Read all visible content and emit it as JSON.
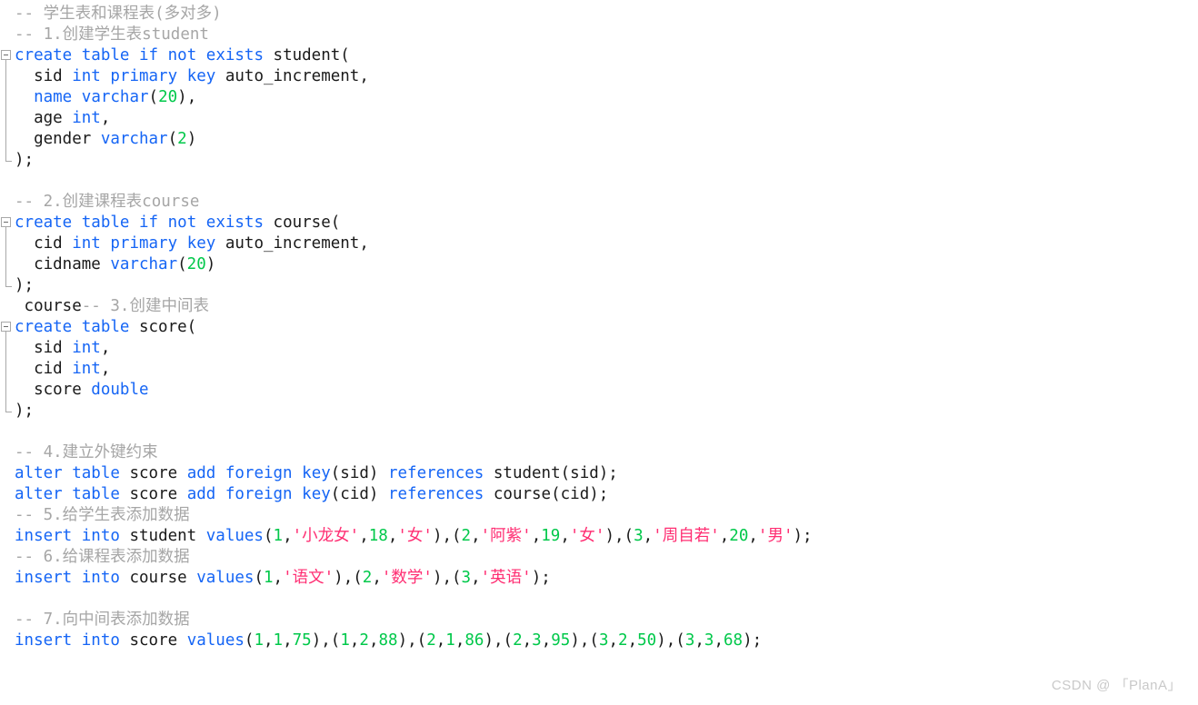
{
  "editor": {
    "language": "sql",
    "background_color": "#ffffff",
    "colors": {
      "keyword": "#1565f5",
      "string": "#ff2d72",
      "number": "#00c84a",
      "comment": "#a6a6a6",
      "text": "#1a1a1a",
      "fold_marker": "#a8a8a8"
    }
  },
  "watermark": {
    "text": "CSDN @ 「PlanA」"
  },
  "code_lines": [
    {
      "n": 1,
      "tokens": [
        {
          "t": "-- 学生表和课程表(多对多)",
          "c": "cmt"
        }
      ]
    },
    {
      "n": 2,
      "tokens": [
        {
          "t": "-- 1.创建学生表student",
          "c": "cmt"
        }
      ]
    },
    {
      "n": 3,
      "fold": "start",
      "tokens": [
        {
          "t": "create",
          "c": "kw"
        },
        {
          "t": " ",
          "c": "plain"
        },
        {
          "t": "table",
          "c": "kw"
        },
        {
          "t": " ",
          "c": "plain"
        },
        {
          "t": "if",
          "c": "kw"
        },
        {
          "t": " ",
          "c": "plain"
        },
        {
          "t": "not",
          "c": "kw"
        },
        {
          "t": " ",
          "c": "plain"
        },
        {
          "t": "exists",
          "c": "kw"
        },
        {
          "t": " student(",
          "c": "plain"
        }
      ]
    },
    {
      "n": 4,
      "tokens": [
        {
          "t": "  sid ",
          "c": "plain"
        },
        {
          "t": "int",
          "c": "kw"
        },
        {
          "t": " ",
          "c": "plain"
        },
        {
          "t": "primary",
          "c": "kw"
        },
        {
          "t": " ",
          "c": "plain"
        },
        {
          "t": "key",
          "c": "kw"
        },
        {
          "t": " auto_increment,",
          "c": "plain"
        }
      ]
    },
    {
      "n": 5,
      "tokens": [
        {
          "t": "  ",
          "c": "plain"
        },
        {
          "t": "name",
          "c": "kw"
        },
        {
          "t": " ",
          "c": "plain"
        },
        {
          "t": "varchar",
          "c": "kw"
        },
        {
          "t": "(",
          "c": "punct"
        },
        {
          "t": "20",
          "c": "num"
        },
        {
          "t": "),",
          "c": "punct"
        }
      ]
    },
    {
      "n": 6,
      "tokens": [
        {
          "t": "  age ",
          "c": "plain"
        },
        {
          "t": "int",
          "c": "kw"
        },
        {
          "t": ",",
          "c": "punct"
        }
      ]
    },
    {
      "n": 7,
      "tokens": [
        {
          "t": "  gender ",
          "c": "plain"
        },
        {
          "t": "varchar",
          "c": "kw"
        },
        {
          "t": "(",
          "c": "punct"
        },
        {
          "t": "2",
          "c": "num"
        },
        {
          "t": ")",
          "c": "punct"
        }
      ]
    },
    {
      "n": 8,
      "fold": "end",
      "tokens": [
        {
          "t": ");",
          "c": "plain"
        }
      ]
    },
    {
      "n": 9,
      "tokens": [
        {
          "t": "",
          "c": "plain"
        }
      ]
    },
    {
      "n": 10,
      "tokens": [
        {
          "t": "-- 2.创建课程表course",
          "c": "cmt"
        }
      ]
    },
    {
      "n": 11,
      "fold": "start",
      "tokens": [
        {
          "t": "create",
          "c": "kw"
        },
        {
          "t": " ",
          "c": "plain"
        },
        {
          "t": "table",
          "c": "kw"
        },
        {
          "t": " ",
          "c": "plain"
        },
        {
          "t": "if",
          "c": "kw"
        },
        {
          "t": " ",
          "c": "plain"
        },
        {
          "t": "not",
          "c": "kw"
        },
        {
          "t": " ",
          "c": "plain"
        },
        {
          "t": "exists",
          "c": "kw"
        },
        {
          "t": " course(",
          "c": "plain"
        }
      ]
    },
    {
      "n": 12,
      "tokens": [
        {
          "t": "  cid ",
          "c": "plain"
        },
        {
          "t": "int",
          "c": "kw"
        },
        {
          "t": " ",
          "c": "plain"
        },
        {
          "t": "primary",
          "c": "kw"
        },
        {
          "t": " ",
          "c": "plain"
        },
        {
          "t": "key",
          "c": "kw"
        },
        {
          "t": " auto_increment,",
          "c": "plain"
        }
      ]
    },
    {
      "n": 13,
      "tokens": [
        {
          "t": "  cidname ",
          "c": "plain"
        },
        {
          "t": "varchar",
          "c": "kw"
        },
        {
          "t": "(",
          "c": "punct"
        },
        {
          "t": "20",
          "c": "num"
        },
        {
          "t": ")",
          "c": "punct"
        }
      ]
    },
    {
      "n": 14,
      "fold": "end",
      "tokens": [
        {
          "t": ");",
          "c": "plain"
        }
      ]
    },
    {
      "n": 15,
      "tokens": [
        {
          "t": " course",
          "c": "plain"
        },
        {
          "t": "-- 3.创建中间表",
          "c": "cmt"
        }
      ]
    },
    {
      "n": 16,
      "fold": "start",
      "tokens": [
        {
          "t": "create",
          "c": "kw"
        },
        {
          "t": " ",
          "c": "plain"
        },
        {
          "t": "table",
          "c": "kw"
        },
        {
          "t": " score(",
          "c": "plain"
        }
      ]
    },
    {
      "n": 17,
      "tokens": [
        {
          "t": "  sid ",
          "c": "plain"
        },
        {
          "t": "int",
          "c": "kw"
        },
        {
          "t": ",",
          "c": "punct"
        }
      ]
    },
    {
      "n": 18,
      "tokens": [
        {
          "t": "  cid ",
          "c": "plain"
        },
        {
          "t": "int",
          "c": "kw"
        },
        {
          "t": ",",
          "c": "punct"
        }
      ]
    },
    {
      "n": 19,
      "tokens": [
        {
          "t": "  score ",
          "c": "plain"
        },
        {
          "t": "double",
          "c": "kw"
        }
      ]
    },
    {
      "n": 20,
      "fold": "end",
      "tokens": [
        {
          "t": ");",
          "c": "plain"
        }
      ]
    },
    {
      "n": 21,
      "tokens": [
        {
          "t": "",
          "c": "plain"
        }
      ]
    },
    {
      "n": 22,
      "tokens": [
        {
          "t": "-- 4.建立外键约束",
          "c": "cmt"
        }
      ]
    },
    {
      "n": 23,
      "tokens": [
        {
          "t": "alter",
          "c": "kw"
        },
        {
          "t": " ",
          "c": "plain"
        },
        {
          "t": "table",
          "c": "kw"
        },
        {
          "t": " score ",
          "c": "plain"
        },
        {
          "t": "add",
          "c": "kw"
        },
        {
          "t": " ",
          "c": "plain"
        },
        {
          "t": "foreign",
          "c": "kw"
        },
        {
          "t": " ",
          "c": "plain"
        },
        {
          "t": "key",
          "c": "kw"
        },
        {
          "t": "(sid) ",
          "c": "plain"
        },
        {
          "t": "references",
          "c": "kw"
        },
        {
          "t": " student(sid);",
          "c": "plain"
        }
      ]
    },
    {
      "n": 24,
      "tokens": [
        {
          "t": "alter",
          "c": "kw"
        },
        {
          "t": " ",
          "c": "plain"
        },
        {
          "t": "table",
          "c": "kw"
        },
        {
          "t": " score ",
          "c": "plain"
        },
        {
          "t": "add",
          "c": "kw"
        },
        {
          "t": " ",
          "c": "plain"
        },
        {
          "t": "foreign",
          "c": "kw"
        },
        {
          "t": " ",
          "c": "plain"
        },
        {
          "t": "key",
          "c": "kw"
        },
        {
          "t": "(cid) ",
          "c": "plain"
        },
        {
          "t": "references",
          "c": "kw"
        },
        {
          "t": " course(cid);",
          "c": "plain"
        }
      ]
    },
    {
      "n": 25,
      "tokens": [
        {
          "t": "-- 5.给学生表添加数据",
          "c": "cmt"
        }
      ]
    },
    {
      "n": 26,
      "tokens": [
        {
          "t": "insert",
          "c": "kw"
        },
        {
          "t": " ",
          "c": "plain"
        },
        {
          "t": "into",
          "c": "kw"
        },
        {
          "t": " student ",
          "c": "plain"
        },
        {
          "t": "values",
          "c": "kw"
        },
        {
          "t": "(",
          "c": "punct"
        },
        {
          "t": "1",
          "c": "num"
        },
        {
          "t": ",",
          "c": "punct"
        },
        {
          "t": "'小龙女'",
          "c": "str"
        },
        {
          "t": ",",
          "c": "punct"
        },
        {
          "t": "18",
          "c": "num"
        },
        {
          "t": ",",
          "c": "punct"
        },
        {
          "t": "'女'",
          "c": "str"
        },
        {
          "t": "),(",
          "c": "punct"
        },
        {
          "t": "2",
          "c": "num"
        },
        {
          "t": ",",
          "c": "punct"
        },
        {
          "t": "'阿紫'",
          "c": "str"
        },
        {
          "t": ",",
          "c": "punct"
        },
        {
          "t": "19",
          "c": "num"
        },
        {
          "t": ",",
          "c": "punct"
        },
        {
          "t": "'女'",
          "c": "str"
        },
        {
          "t": "),(",
          "c": "punct"
        },
        {
          "t": "3",
          "c": "num"
        },
        {
          "t": ",",
          "c": "punct"
        },
        {
          "t": "'周自若'",
          "c": "str"
        },
        {
          "t": ",",
          "c": "punct"
        },
        {
          "t": "20",
          "c": "num"
        },
        {
          "t": ",",
          "c": "punct"
        },
        {
          "t": "'男'",
          "c": "str"
        },
        {
          "t": ");",
          "c": "punct"
        }
      ]
    },
    {
      "n": 27,
      "tokens": [
        {
          "t": "-- 6.给课程表添加数据",
          "c": "cmt"
        }
      ]
    },
    {
      "n": 28,
      "tokens": [
        {
          "t": "insert",
          "c": "kw"
        },
        {
          "t": " ",
          "c": "plain"
        },
        {
          "t": "into",
          "c": "kw"
        },
        {
          "t": " course ",
          "c": "plain"
        },
        {
          "t": "values",
          "c": "kw"
        },
        {
          "t": "(",
          "c": "punct"
        },
        {
          "t": "1",
          "c": "num"
        },
        {
          "t": ",",
          "c": "punct"
        },
        {
          "t": "'语文'",
          "c": "str"
        },
        {
          "t": "),(",
          "c": "punct"
        },
        {
          "t": "2",
          "c": "num"
        },
        {
          "t": ",",
          "c": "punct"
        },
        {
          "t": "'数学'",
          "c": "str"
        },
        {
          "t": "),(",
          "c": "punct"
        },
        {
          "t": "3",
          "c": "num"
        },
        {
          "t": ",",
          "c": "punct"
        },
        {
          "t": "'英语'",
          "c": "str"
        },
        {
          "t": ");",
          "c": "punct"
        }
      ]
    },
    {
      "n": 29,
      "tokens": [
        {
          "t": "",
          "c": "plain"
        }
      ]
    },
    {
      "n": 30,
      "tokens": [
        {
          "t": "-- 7.向中间表添加数据",
          "c": "cmt"
        }
      ]
    },
    {
      "n": 31,
      "tokens": [
        {
          "t": "insert",
          "c": "kw"
        },
        {
          "t": " ",
          "c": "plain"
        },
        {
          "t": "into",
          "c": "kw"
        },
        {
          "t": " score ",
          "c": "plain"
        },
        {
          "t": "values",
          "c": "kw"
        },
        {
          "t": "(",
          "c": "punct"
        },
        {
          "t": "1",
          "c": "num"
        },
        {
          "t": ",",
          "c": "punct"
        },
        {
          "t": "1",
          "c": "num"
        },
        {
          "t": ",",
          "c": "punct"
        },
        {
          "t": "75",
          "c": "num"
        },
        {
          "t": "),(",
          "c": "punct"
        },
        {
          "t": "1",
          "c": "num"
        },
        {
          "t": ",",
          "c": "punct"
        },
        {
          "t": "2",
          "c": "num"
        },
        {
          "t": ",",
          "c": "punct"
        },
        {
          "t": "88",
          "c": "num"
        },
        {
          "t": "),(",
          "c": "punct"
        },
        {
          "t": "2",
          "c": "num"
        },
        {
          "t": ",",
          "c": "punct"
        },
        {
          "t": "1",
          "c": "num"
        },
        {
          "t": ",",
          "c": "punct"
        },
        {
          "t": "86",
          "c": "num"
        },
        {
          "t": "),(",
          "c": "punct"
        },
        {
          "t": "2",
          "c": "num"
        },
        {
          "t": ",",
          "c": "punct"
        },
        {
          "t": "3",
          "c": "num"
        },
        {
          "t": ",",
          "c": "punct"
        },
        {
          "t": "95",
          "c": "num"
        },
        {
          "t": "),(",
          "c": "punct"
        },
        {
          "t": "3",
          "c": "num"
        },
        {
          "t": ",",
          "c": "punct"
        },
        {
          "t": "2",
          "c": "num"
        },
        {
          "t": ",",
          "c": "punct"
        },
        {
          "t": "50",
          "c": "num"
        },
        {
          "t": "),(",
          "c": "punct"
        },
        {
          "t": "3",
          "c": "num"
        },
        {
          "t": ",",
          "c": "punct"
        },
        {
          "t": "3",
          "c": "num"
        },
        {
          "t": ",",
          "c": "punct"
        },
        {
          "t": "68",
          "c": "num"
        },
        {
          "t": ");",
          "c": "punct"
        }
      ]
    }
  ]
}
